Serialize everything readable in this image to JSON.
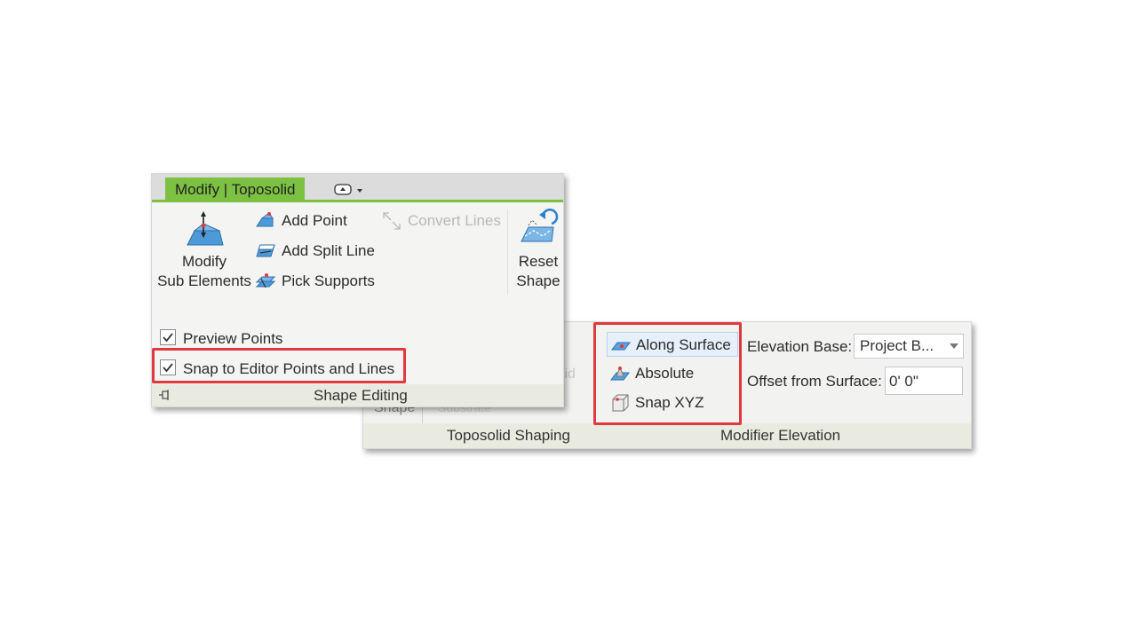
{
  "front_panel": {
    "tab_label": "Modify | Toposolid",
    "commands": {
      "modify_sub_elements": [
        "Modify",
        "Sub Elements"
      ],
      "add_point": "Add Point",
      "add_split_line": "Add Split Line",
      "pick_supports": "Pick Supports",
      "convert_lines": "Convert Lines",
      "reset_shape": [
        "Reset",
        "Shape"
      ]
    },
    "options": {
      "preview_points": {
        "label": "Preview Points",
        "checked": true
      },
      "snap_to_editor": {
        "label": "Snap to Editor Points and Lines",
        "checked": true
      }
    },
    "footer_label": "Shape Editing"
  },
  "back_panel": {
    "ghost_texts": {
      "solid": "olid",
      "shape": "Shape",
      "partial": "Substrate"
    },
    "modes": [
      {
        "label": "Along Surface",
        "icon": "along-surface-icon",
        "selected": true
      },
      {
        "label": "Absolute",
        "icon": "absolute-icon",
        "selected": false
      },
      {
        "label": "Snap XYZ",
        "icon": "snap-xyz-icon",
        "selected": false
      }
    ],
    "elevation_base_label": "Elevation Base:",
    "elevation_base_value": "Project B...",
    "offset_label": "Offset from Surface:",
    "offset_value": "0'  0\"",
    "footer_labels": {
      "left": "Toposolid Shaping",
      "right": "Modifier Elevation"
    }
  },
  "colors": {
    "accent_green": "#7cc142",
    "highlight_red": "#e03a3e",
    "selection_blue": "#e5f0fb"
  }
}
